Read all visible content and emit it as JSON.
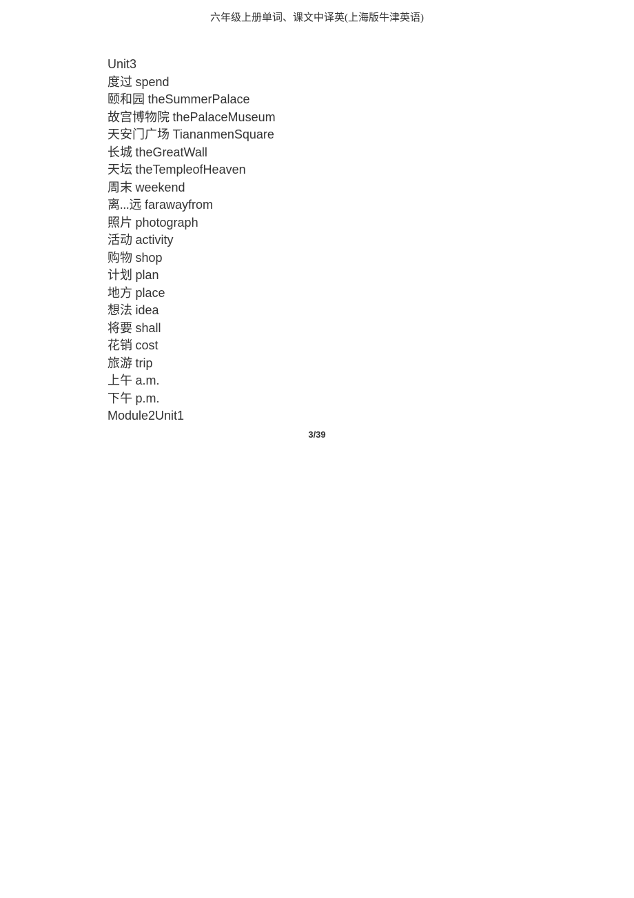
{
  "header": "六年级上册单词、课文中译英(上海版牛津英语)",
  "lines": [
    {
      "cn": "",
      "en": "Unit3"
    },
    {
      "cn": "度过 ",
      "en": "spend"
    },
    {
      "cn": "颐和园 ",
      "en": "theSummerPalace"
    },
    {
      "cn": "故宫博物院 ",
      "en": "thePalaceMuseum"
    },
    {
      "cn": "天安门广场 ",
      "en": "TiananmenSquare"
    },
    {
      "cn": "长城 ",
      "en": "theGreatWall"
    },
    {
      "cn": "天坛 ",
      "en": "theTempleofHeaven"
    },
    {
      "cn": "周末 ",
      "en": "weekend"
    },
    {
      "cn": "离...远 ",
      "en": "farawayfrom"
    },
    {
      "cn": "照片 ",
      "en": "photograph"
    },
    {
      "cn": "活动 ",
      "en": "activity"
    },
    {
      "cn": "购物 ",
      "en": "shop"
    },
    {
      "cn": "计划 ",
      "en": "plan"
    },
    {
      "cn": "地方 ",
      "en": "place"
    },
    {
      "cn": "想法 ",
      "en": "idea"
    },
    {
      "cn": "将要 ",
      "en": "shall"
    },
    {
      "cn": "花销 ",
      "en": "cost"
    },
    {
      "cn": "旅游 ",
      "en": "trip"
    },
    {
      "cn": "上午 ",
      "en": "a.m."
    },
    {
      "cn": "下午 ",
      "en": "p.m."
    },
    {
      "cn": "",
      "en": "Module2Unit1"
    }
  ],
  "footer": "3/39"
}
